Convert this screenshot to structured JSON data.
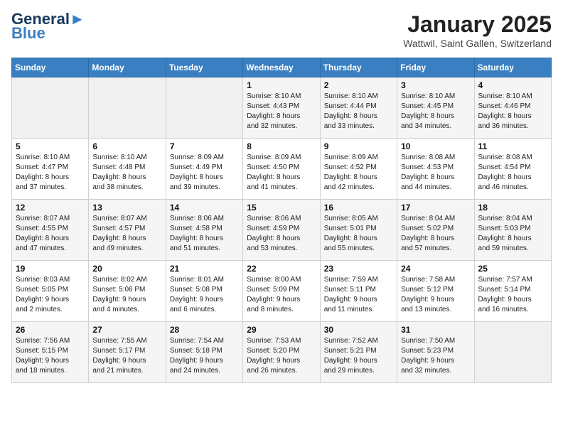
{
  "header": {
    "logo_line1": "General",
    "logo_line2": "Blue",
    "month": "January 2025",
    "location": "Wattwil, Saint Gallen, Switzerland"
  },
  "weekdays": [
    "Sunday",
    "Monday",
    "Tuesday",
    "Wednesday",
    "Thursday",
    "Friday",
    "Saturday"
  ],
  "weeks": [
    [
      {
        "day": "",
        "info": ""
      },
      {
        "day": "",
        "info": ""
      },
      {
        "day": "",
        "info": ""
      },
      {
        "day": "1",
        "info": "Sunrise: 8:10 AM\nSunset: 4:43 PM\nDaylight: 8 hours\nand 32 minutes."
      },
      {
        "day": "2",
        "info": "Sunrise: 8:10 AM\nSunset: 4:44 PM\nDaylight: 8 hours\nand 33 minutes."
      },
      {
        "day": "3",
        "info": "Sunrise: 8:10 AM\nSunset: 4:45 PM\nDaylight: 8 hours\nand 34 minutes."
      },
      {
        "day": "4",
        "info": "Sunrise: 8:10 AM\nSunset: 4:46 PM\nDaylight: 8 hours\nand 36 minutes."
      }
    ],
    [
      {
        "day": "5",
        "info": "Sunrise: 8:10 AM\nSunset: 4:47 PM\nDaylight: 8 hours\nand 37 minutes."
      },
      {
        "day": "6",
        "info": "Sunrise: 8:10 AM\nSunset: 4:48 PM\nDaylight: 8 hours\nand 38 minutes."
      },
      {
        "day": "7",
        "info": "Sunrise: 8:09 AM\nSunset: 4:49 PM\nDaylight: 8 hours\nand 39 minutes."
      },
      {
        "day": "8",
        "info": "Sunrise: 8:09 AM\nSunset: 4:50 PM\nDaylight: 8 hours\nand 41 minutes."
      },
      {
        "day": "9",
        "info": "Sunrise: 8:09 AM\nSunset: 4:52 PM\nDaylight: 8 hours\nand 42 minutes."
      },
      {
        "day": "10",
        "info": "Sunrise: 8:08 AM\nSunset: 4:53 PM\nDaylight: 8 hours\nand 44 minutes."
      },
      {
        "day": "11",
        "info": "Sunrise: 8:08 AM\nSunset: 4:54 PM\nDaylight: 8 hours\nand 46 minutes."
      }
    ],
    [
      {
        "day": "12",
        "info": "Sunrise: 8:07 AM\nSunset: 4:55 PM\nDaylight: 8 hours\nand 47 minutes."
      },
      {
        "day": "13",
        "info": "Sunrise: 8:07 AM\nSunset: 4:57 PM\nDaylight: 8 hours\nand 49 minutes."
      },
      {
        "day": "14",
        "info": "Sunrise: 8:06 AM\nSunset: 4:58 PM\nDaylight: 8 hours\nand 51 minutes."
      },
      {
        "day": "15",
        "info": "Sunrise: 8:06 AM\nSunset: 4:59 PM\nDaylight: 8 hours\nand 53 minutes."
      },
      {
        "day": "16",
        "info": "Sunrise: 8:05 AM\nSunset: 5:01 PM\nDaylight: 8 hours\nand 55 minutes."
      },
      {
        "day": "17",
        "info": "Sunrise: 8:04 AM\nSunset: 5:02 PM\nDaylight: 8 hours\nand 57 minutes."
      },
      {
        "day": "18",
        "info": "Sunrise: 8:04 AM\nSunset: 5:03 PM\nDaylight: 8 hours\nand 59 minutes."
      }
    ],
    [
      {
        "day": "19",
        "info": "Sunrise: 8:03 AM\nSunset: 5:05 PM\nDaylight: 9 hours\nand 2 minutes."
      },
      {
        "day": "20",
        "info": "Sunrise: 8:02 AM\nSunset: 5:06 PM\nDaylight: 9 hours\nand 4 minutes."
      },
      {
        "day": "21",
        "info": "Sunrise: 8:01 AM\nSunset: 5:08 PM\nDaylight: 9 hours\nand 6 minutes."
      },
      {
        "day": "22",
        "info": "Sunrise: 8:00 AM\nSunset: 5:09 PM\nDaylight: 9 hours\nand 8 minutes."
      },
      {
        "day": "23",
        "info": "Sunrise: 7:59 AM\nSunset: 5:11 PM\nDaylight: 9 hours\nand 11 minutes."
      },
      {
        "day": "24",
        "info": "Sunrise: 7:58 AM\nSunset: 5:12 PM\nDaylight: 9 hours\nand 13 minutes."
      },
      {
        "day": "25",
        "info": "Sunrise: 7:57 AM\nSunset: 5:14 PM\nDaylight: 9 hours\nand 16 minutes."
      }
    ],
    [
      {
        "day": "26",
        "info": "Sunrise: 7:56 AM\nSunset: 5:15 PM\nDaylight: 9 hours\nand 18 minutes."
      },
      {
        "day": "27",
        "info": "Sunrise: 7:55 AM\nSunset: 5:17 PM\nDaylight: 9 hours\nand 21 minutes."
      },
      {
        "day": "28",
        "info": "Sunrise: 7:54 AM\nSunset: 5:18 PM\nDaylight: 9 hours\nand 24 minutes."
      },
      {
        "day": "29",
        "info": "Sunrise: 7:53 AM\nSunset: 5:20 PM\nDaylight: 9 hours\nand 26 minutes."
      },
      {
        "day": "30",
        "info": "Sunrise: 7:52 AM\nSunset: 5:21 PM\nDaylight: 9 hours\nand 29 minutes."
      },
      {
        "day": "31",
        "info": "Sunrise: 7:50 AM\nSunset: 5:23 PM\nDaylight: 9 hours\nand 32 minutes."
      },
      {
        "day": "",
        "info": ""
      }
    ]
  ]
}
